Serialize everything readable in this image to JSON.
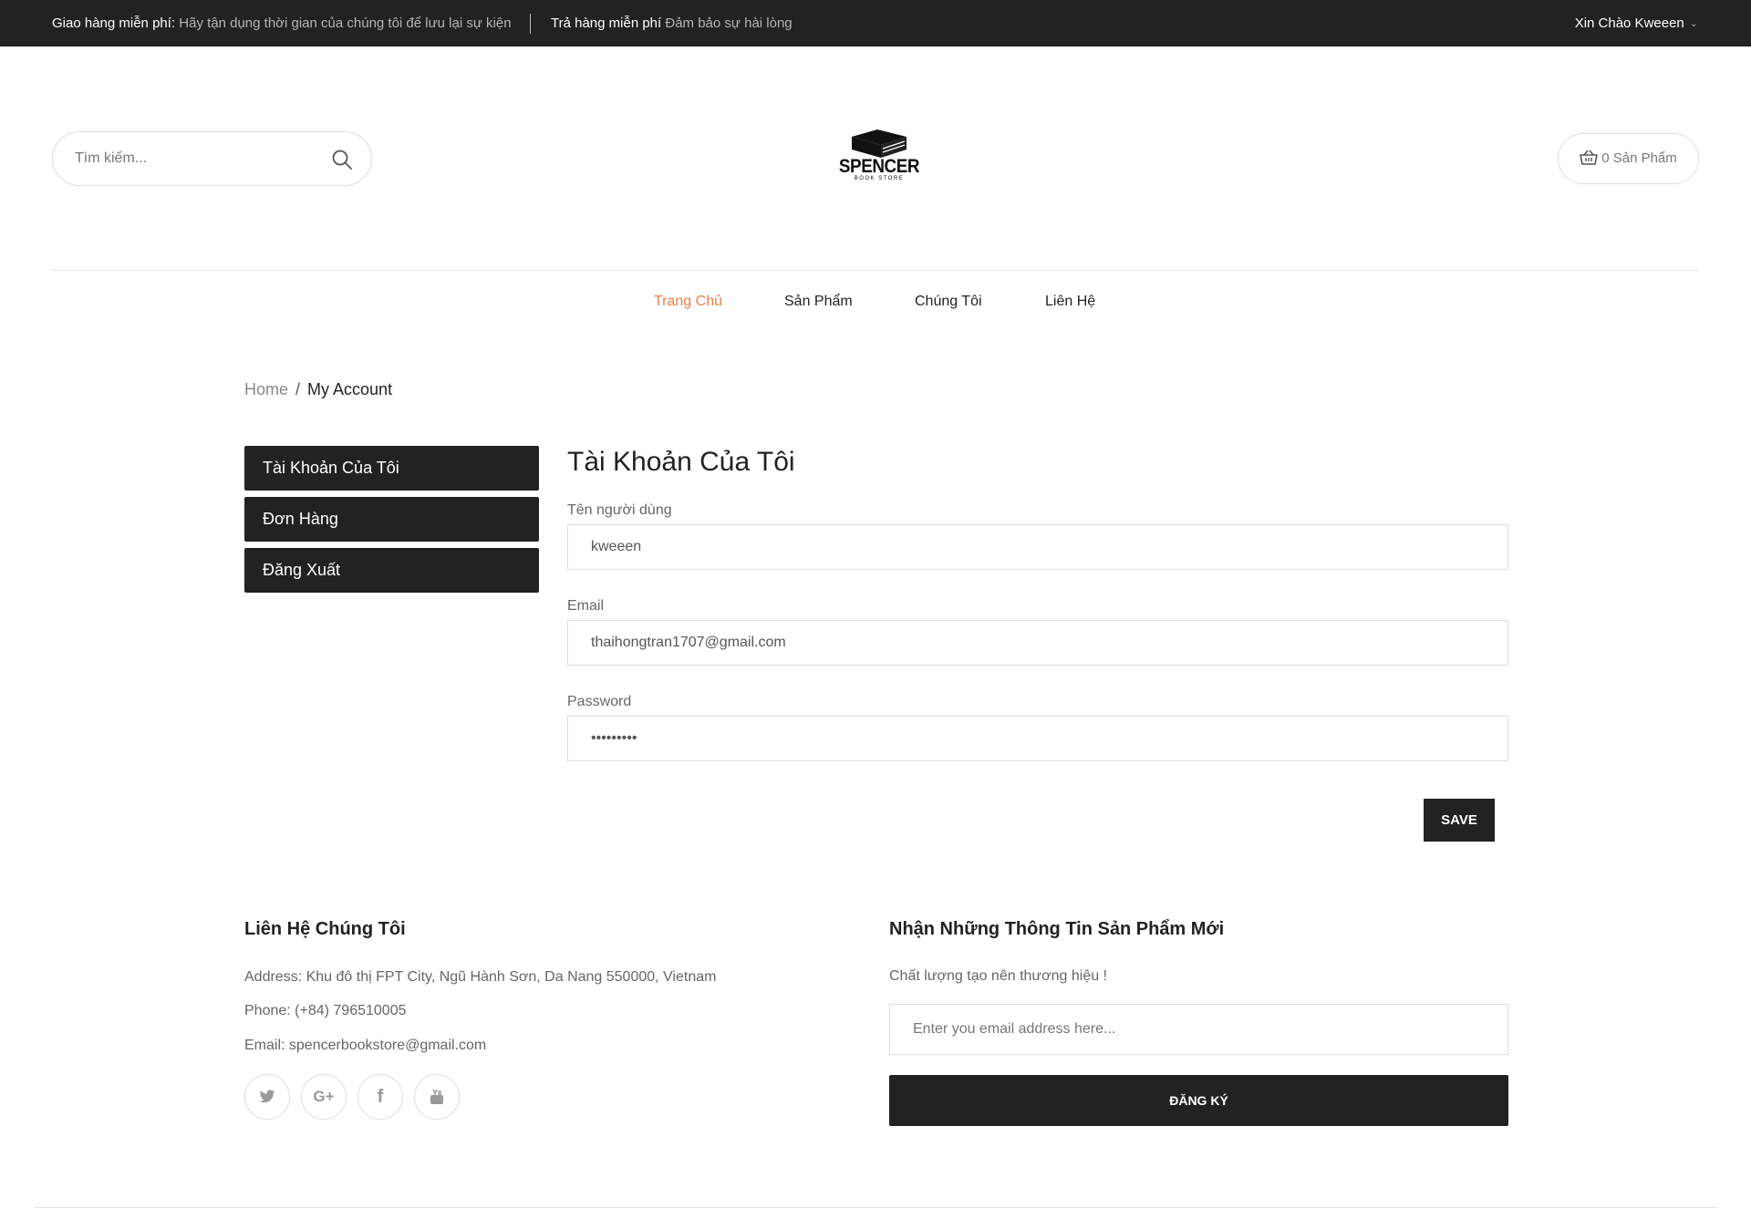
{
  "topbar": {
    "promo1_title": "Giao hàng miễn phí:",
    "promo1_text": "Hãy tận dụng thời gian của chúng tôi để lưu lại sự kiện",
    "promo2_title": "Trả hàng miễn phí",
    "promo2_text": "Đảm bảo sự hài lòng",
    "greeting": "Xin Chào Kweeen",
    "greeting_icon": "chevron-down-icon"
  },
  "header": {
    "search_placeholder": "Tìm kiếm...",
    "search_icon": "search-icon",
    "logo_text": "SPENCER",
    "logo_subtext": "BOOK STORE",
    "cart_icon": "basket-icon",
    "cart_label": "0 Sản Phẩm"
  },
  "nav": {
    "items": [
      {
        "label": "Trang Chủ",
        "active": true
      },
      {
        "label": "Sản Phẩm",
        "active": false
      },
      {
        "label": "Chúng Tôi",
        "active": false
      },
      {
        "label": "Liên Hệ",
        "active": false
      }
    ]
  },
  "breadcrumb": {
    "home": "Home",
    "separator": "/",
    "current": "My Account"
  },
  "sidebar": {
    "items": [
      {
        "label": "Tài Khoản Của Tôi"
      },
      {
        "label": "Đơn Hàng"
      },
      {
        "label": "Đăng Xuất"
      }
    ]
  },
  "account": {
    "title": "Tài Khoản Của Tôi",
    "username_label": "Tên người dùng",
    "username_value": "kweeen",
    "email_label": "Email",
    "email_value": "thaihongtran1707@gmail.com",
    "password_label": "Password",
    "password_value": "123456789",
    "save_label": "SAVE"
  },
  "footer": {
    "contact_title": "Liên Hệ Chúng Tôi",
    "address": "Address: Khu đô thị FPT City, Ngũ Hành Sơn, Da Nang 550000, Vietnam",
    "phone": "Phone: (+84) 796510005",
    "email": "Email: spencerbookstore@gmail.com",
    "social_icons": [
      "twitter-icon",
      "google-plus-icon",
      "facebook-icon",
      "youtube-icon"
    ],
    "newsletter_title": "Nhận Những Thông Tin Sản Phẩm Mới",
    "newsletter_text": "Chất lượng tạo nên thương hiệu !",
    "newsletter_placeholder": "Enter you email address here...",
    "newsletter_button": "ĐĂNG KÝ"
  },
  "colors": {
    "dark": "#222222",
    "accent": "#f07c4b",
    "border": "#dddddd"
  }
}
